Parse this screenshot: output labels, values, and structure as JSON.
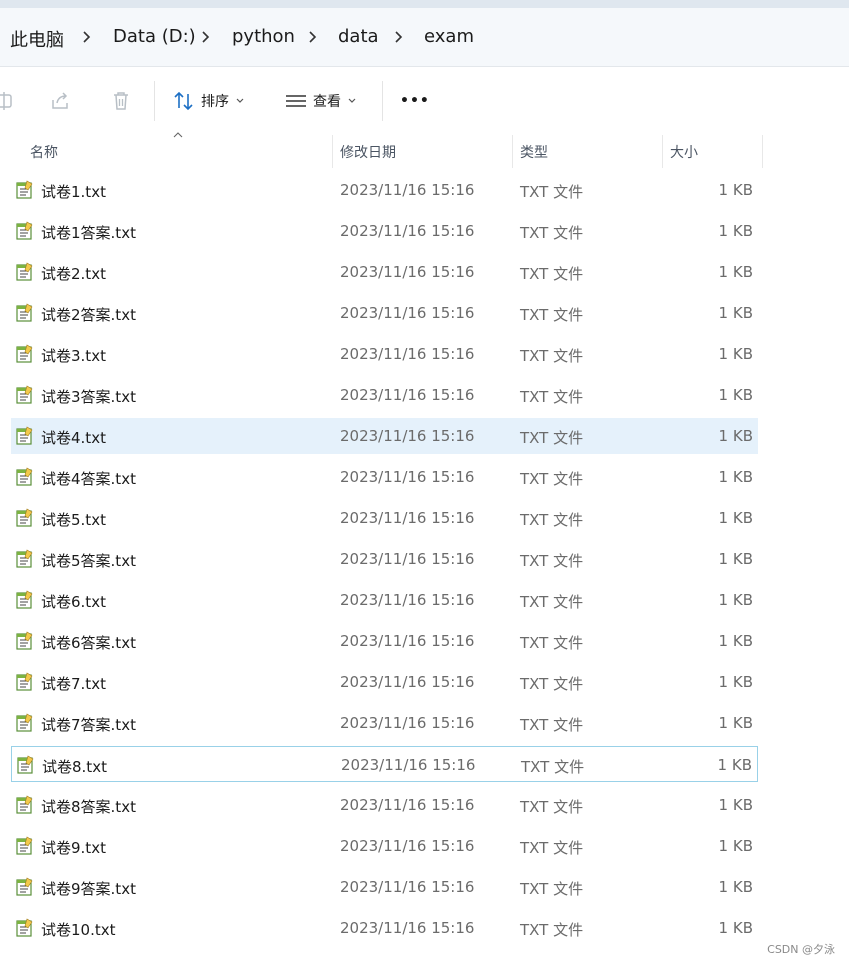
{
  "breadcrumb": [
    "此电脑",
    "Data (D:)",
    "python",
    "data",
    "exam"
  ],
  "toolbar": {
    "sort_label": "排序",
    "view_label": "查看",
    "more_label": "•••"
  },
  "columns": {
    "name": "名称",
    "modified": "修改日期",
    "type": "类型",
    "size": "大小"
  },
  "files": [
    {
      "name": "试卷1.txt",
      "modified": "2023/11/16 15:16",
      "type": "TXT 文件",
      "size": "1 KB"
    },
    {
      "name": "试卷1答案.txt",
      "modified": "2023/11/16 15:16",
      "type": "TXT 文件",
      "size": "1 KB"
    },
    {
      "name": "试卷2.txt",
      "modified": "2023/11/16 15:16",
      "type": "TXT 文件",
      "size": "1 KB"
    },
    {
      "name": "试卷2答案.txt",
      "modified": "2023/11/16 15:16",
      "type": "TXT 文件",
      "size": "1 KB"
    },
    {
      "name": "试卷3.txt",
      "modified": "2023/11/16 15:16",
      "type": "TXT 文件",
      "size": "1 KB"
    },
    {
      "name": "试卷3答案.txt",
      "modified": "2023/11/16 15:16",
      "type": "TXT 文件",
      "size": "1 KB"
    },
    {
      "name": "试卷4.txt",
      "modified": "2023/11/16 15:16",
      "type": "TXT 文件",
      "size": "1 KB"
    },
    {
      "name": "试卷4答案.txt",
      "modified": "2023/11/16 15:16",
      "type": "TXT 文件",
      "size": "1 KB"
    },
    {
      "name": "试卷5.txt",
      "modified": "2023/11/16 15:16",
      "type": "TXT 文件",
      "size": "1 KB"
    },
    {
      "name": "试卷5答案.txt",
      "modified": "2023/11/16 15:16",
      "type": "TXT 文件",
      "size": "1 KB"
    },
    {
      "name": "试卷6.txt",
      "modified": "2023/11/16 15:16",
      "type": "TXT 文件",
      "size": "1 KB"
    },
    {
      "name": "试卷6答案.txt",
      "modified": "2023/11/16 15:16",
      "type": "TXT 文件",
      "size": "1 KB"
    },
    {
      "name": "试卷7.txt",
      "modified": "2023/11/16 15:16",
      "type": "TXT 文件",
      "size": "1 KB"
    },
    {
      "name": "试卷7答案.txt",
      "modified": "2023/11/16 15:16",
      "type": "TXT 文件",
      "size": "1 KB"
    },
    {
      "name": "试卷8.txt",
      "modified": "2023/11/16 15:16",
      "type": "TXT 文件",
      "size": "1 KB"
    },
    {
      "name": "试卷8答案.txt",
      "modified": "2023/11/16 15:16",
      "type": "TXT 文件",
      "size": "1 KB"
    },
    {
      "name": "试卷9.txt",
      "modified": "2023/11/16 15:16",
      "type": "TXT 文件",
      "size": "1 KB"
    },
    {
      "name": "试卷9答案.txt",
      "modified": "2023/11/16 15:16",
      "type": "TXT 文件",
      "size": "1 KB"
    },
    {
      "name": "试卷10.txt",
      "modified": "2023/11/16 15:16",
      "type": "TXT 文件",
      "size": "1 KB"
    }
  ],
  "hover_index": 6,
  "focus_index": 14,
  "watermark": "CSDN @夕泳",
  "colors": {
    "hover_bg": "#e5f1fb",
    "focus_border": "#99d1e8",
    "address_bg": "#f5f8fb"
  }
}
